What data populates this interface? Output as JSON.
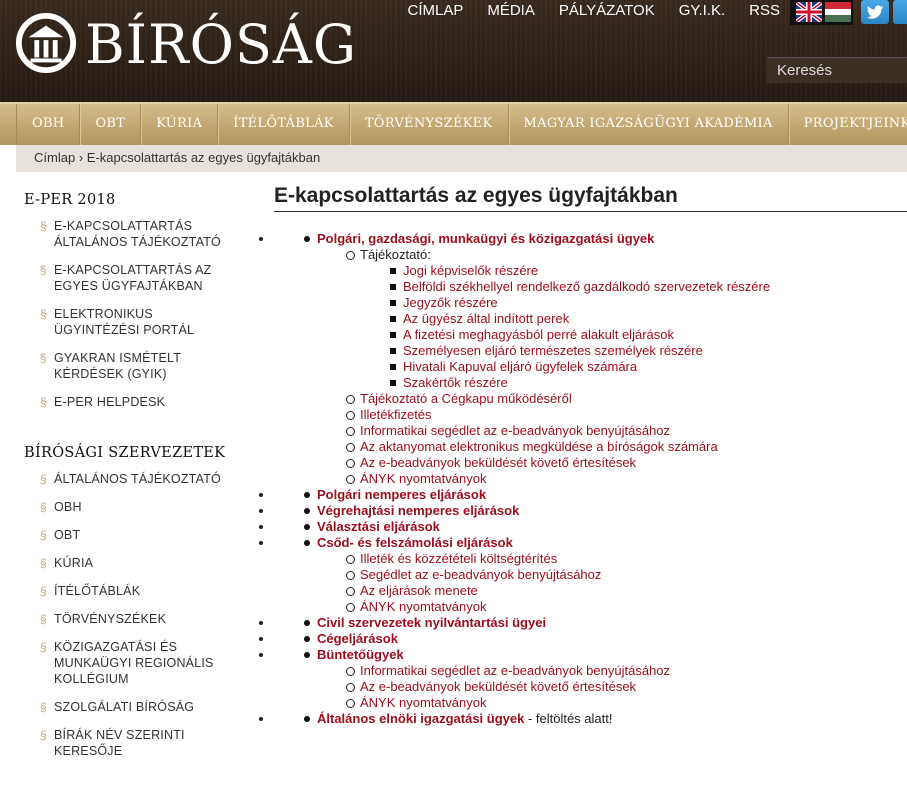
{
  "header": {
    "logo_text": "BÍRÓSÁG",
    "top_links": [
      "CÍMLAP",
      "MÉDIA",
      "PÁLYÁZATOK",
      "GY.I.K.",
      "RSS"
    ],
    "search_placeholder": "Keresés"
  },
  "main_nav": [
    "OBH",
    "OBT",
    "KÚRIA",
    "ÍTÉLŐTÁBLÁK",
    "TÖRVÉNYSZÉKEK",
    "MAGYAR IGAZSÁGÜGYI AKADÉMIA",
    "PROJEKTJEINK"
  ],
  "breadcrumb": {
    "home": "Címlap",
    "separator": "›",
    "current": "E-kapcsolattartás az egyes ügyfajtákban"
  },
  "sidebar": {
    "sections": [
      {
        "title": "E-PER 2018",
        "items": [
          [
            "E-KAPCSOLATTARTÁS",
            "ÁLTALÁNOS TÁJÉKOZTATÓ"
          ],
          [
            "E-KAPCSOLATTARTÁS AZ",
            "EGYES ÜGYFAJTÁKBAN"
          ],
          [
            "ELEKTRONIKUS",
            "ÜGYINTÉZÉSI PORTÁL"
          ],
          [
            "GYAKRAN ISMÉTELT",
            "KÉRDÉSEK (GYIK)"
          ],
          [
            "E-PER HELPDESK"
          ]
        ]
      },
      {
        "title": "BÍRÓSÁGI SZERVEZETEK",
        "items": [
          [
            "ÁLTALÁNOS TÁJÉKOZTATÓ"
          ],
          [
            "OBH"
          ],
          [
            "OBT"
          ],
          [
            "KÚRIA"
          ],
          [
            "ÍTÉLŐTÁBLÁK"
          ],
          [
            "TÖRVÉNYSZÉKEK"
          ],
          [
            "KÖZIGAZGATÁSI ÉS",
            "MUNKAÜGYI REGIONÁLIS",
            "KOLLÉGIUM"
          ],
          [
            "SZOLGÁLATI BÍRÓSÁG"
          ],
          [
            "BÍRÁK NÉV SZERINTI",
            "KERESŐJE"
          ]
        ]
      }
    ]
  },
  "content": {
    "title": "E-kapcsolattartás az egyes ügyfajtákban",
    "tree": [
      {
        "label": "Polgári, gazdasági, munkaügyi és közigazgatási ügyek",
        "children": [
          {
            "label": "Tájékoztató:",
            "link": false,
            "children": [
              "Jogi képviselők részére",
              "Belföldi székhellyel rendelkező gazdálkodó szervezetek részére",
              "Jegyzők részére",
              "Az ügyész által indított perek",
              "A fizetési meghagyásból perré alakult eljárások",
              "Személyesen eljáró természetes személyek részére",
              "Hivatali Kapuval eljáró ügyfelek számára",
              "Szakértők részére"
            ]
          },
          {
            "label": "Tájékoztató a Cégkapu működéséről",
            "link": true
          },
          {
            "label": "Illetékfizetés",
            "link": true
          },
          {
            "label": "Informatikai segédlet az e-beadványok benyújtásához",
            "link": true
          },
          {
            "label": "Az aktanyomat elektronikus megküldése a bíróságok számára",
            "link": true
          },
          {
            "label": "Az e-beadványok beküldését követő értesítések",
            "link": true
          },
          {
            "label": "ÁNYK nyomtatványok",
            "link": true
          }
        ]
      },
      {
        "label": "Polgári nemperes eljárások"
      },
      {
        "label": "Végrehajtási nemperes eljárások"
      },
      {
        "label": "Választási eljárások"
      },
      {
        "label": "Csőd- és felszámolási eljárások",
        "children": [
          {
            "label": "Illeték és közzétételi költségtérítés",
            "link": true
          },
          {
            "label": "Segédlet az e-beadványok benyújtásához",
            "link": true
          },
          {
            "label": "Az eljárások menete",
            "link": true
          },
          {
            "label": "ÁNYK nyomtatványok",
            "link": true
          }
        ]
      },
      {
        "label": "Civil szervezetek nyilvántartási ügyei"
      },
      {
        "label": "Cégeljárások"
      },
      {
        "label": "Büntetőügyek",
        "children": [
          {
            "label": "Informatikai segédlet az e-beadványok benyújtásához",
            "link": true
          },
          {
            "label": "Az e-beadványok beküldését követő értesítések",
            "link": true
          },
          {
            "label": "ÁNYK nyomtatványok",
            "link": true
          }
        ]
      },
      {
        "label": "Általános elnöki igazgatási ügyek",
        "suffix": " - feltöltés alatt!"
      }
    ]
  },
  "colors": {
    "link": "#9b0d1c",
    "header_bg": "#2e2118",
    "nav_gold": "#c3a873",
    "breadcrumb_bg": "#e7e2dc"
  },
  "icons": {
    "logo": "court-logo-icon",
    "flags": [
      "uk-flag-icon",
      "hungary-flag-icon"
    ],
    "social": [
      "twitter-icon",
      "facebook-icon"
    ]
  }
}
